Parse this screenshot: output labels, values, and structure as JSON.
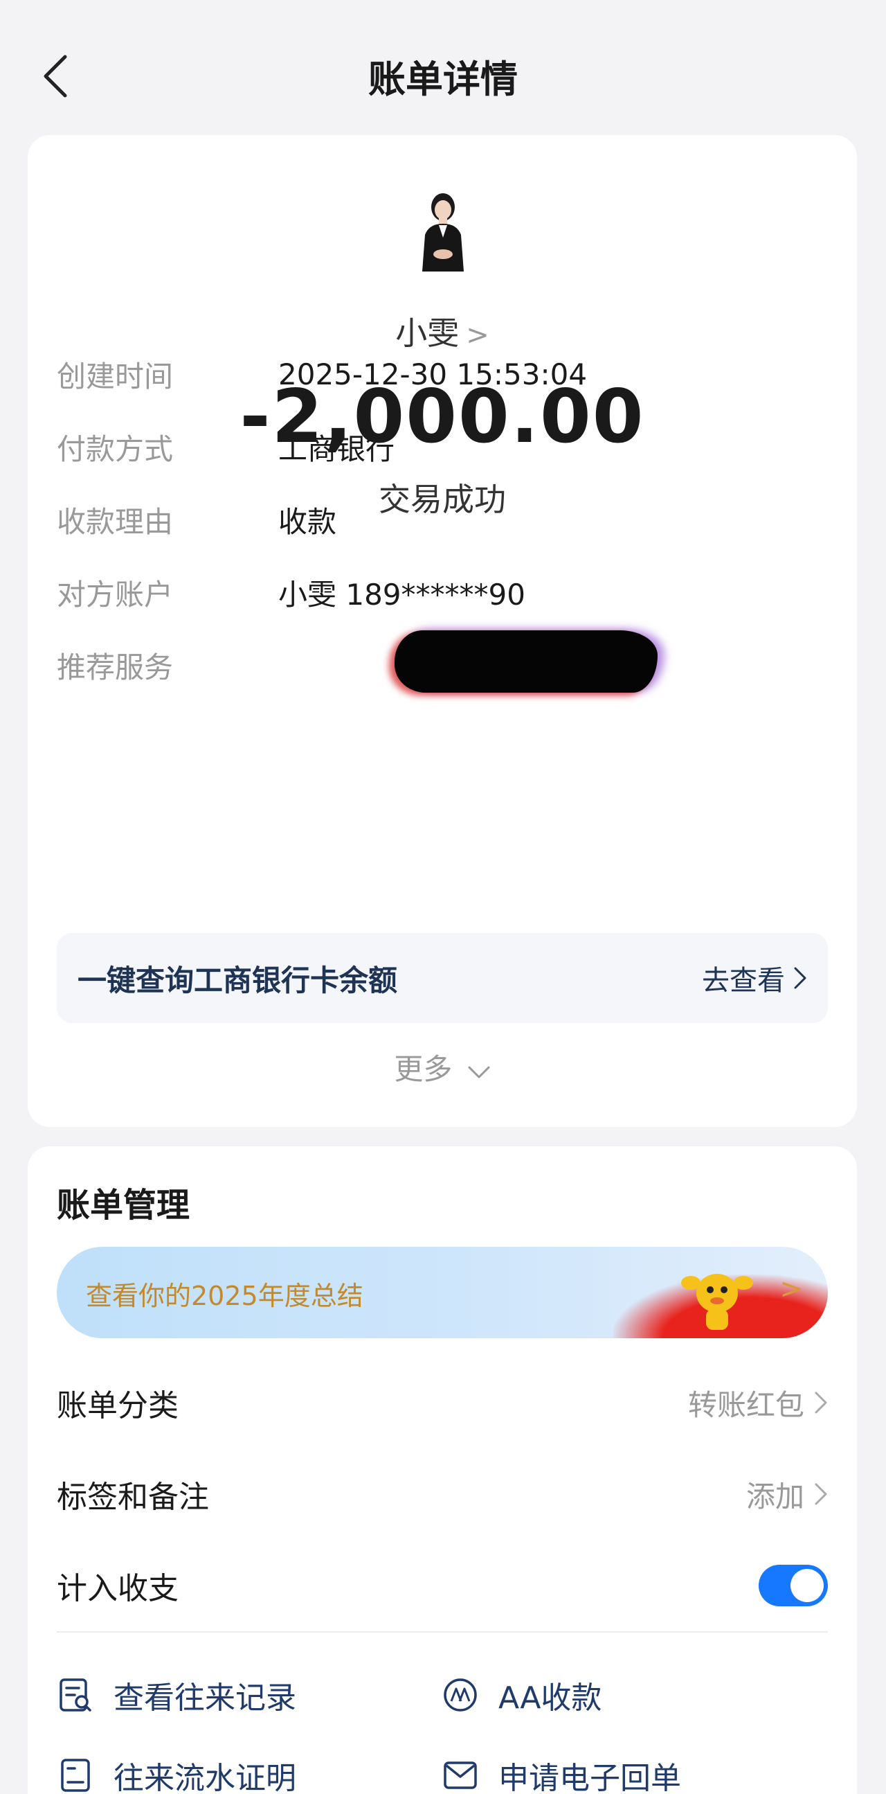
{
  "header": {
    "title": "账单详情"
  },
  "transaction": {
    "payee_name": "小雯",
    "amount": "-2,000.00",
    "status": "交易成功"
  },
  "details": [
    {
      "label": "创建时间",
      "value": "2025-12-30 15:53:04"
    },
    {
      "label": "付款方式",
      "value": "工商银行"
    },
    {
      "label": "收款理由",
      "value": "收款"
    },
    {
      "label": "对方账户",
      "value": "小雯 189******90"
    },
    {
      "label": "推荐服务",
      "value": ""
    }
  ],
  "promo": {
    "text": "一键查询工商银行卡余额",
    "link": "去查看"
  },
  "more_label": "更多",
  "management": {
    "title": "账单管理",
    "banner_text": "查看你的2025年度总结",
    "rows": [
      {
        "label": "账单分类",
        "value": "转账红包"
      },
      {
        "label": "标签和备注",
        "value": "添加"
      },
      {
        "label": "计入收支",
        "value": ""
      }
    ],
    "toggle_on": true,
    "actions": [
      {
        "label": "查看往来记录",
        "icon": "records-icon"
      },
      {
        "label": "AA收款",
        "icon": "aa-icon"
      },
      {
        "label": "往来流水证明",
        "icon": "statement-icon"
      },
      {
        "label": "申请电子回单",
        "icon": "mail-icon"
      }
    ]
  },
  "colors": {
    "accent": "#1677ff",
    "promo_text": "#1f3455",
    "link_text": "#1f3a6b",
    "banner_text": "#c38a2c"
  }
}
